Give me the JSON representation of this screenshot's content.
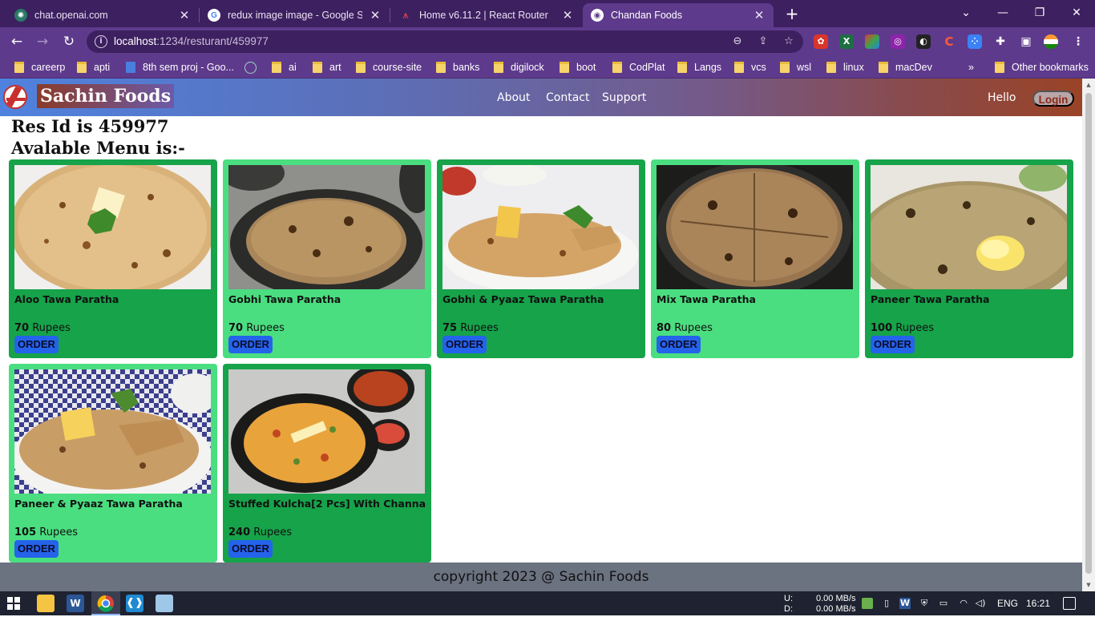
{
  "browser": {
    "tabs": [
      {
        "title": "chat.openai.com",
        "icon": "openai-icon",
        "active": false
      },
      {
        "title": "redux image image - Google Sea",
        "icon": "google-icon",
        "active": false
      },
      {
        "title": "Home v6.11.2 | React Router",
        "icon": "react-router-icon",
        "active": false
      },
      {
        "title": "Chandan Foods",
        "icon": "globe-icon",
        "active": true
      }
    ],
    "url_host": "localhost",
    "url_path": ":1234/resturant/459977",
    "bookmarks": [
      "careerp",
      "apti",
      "8th sem proj - Goo...",
      "ai",
      "art",
      "course-site",
      "banks",
      "digilock",
      "boot",
      "CodPlat",
      "Langs",
      "vcs",
      "wsl",
      "linux",
      "macDev"
    ],
    "bookmarks_more": "»",
    "other_bookmarks": "Other bookmarks"
  },
  "site": {
    "brand": "Sachin Foods",
    "nav": [
      "About",
      "Contact",
      "Support"
    ],
    "greeting": "Hello",
    "login_label": "Login",
    "res_id_text": "Res Id is 459977",
    "menu_heading": "Avalable Menu is:-",
    "footer": "copyright 2023 @ Sachin Foods"
  },
  "menu": [
    {
      "name": "Aloo Tawa Paratha",
      "price": "70",
      "unit": "Rupees",
      "order_label": "ORDER",
      "variant": "dark",
      "image": "paratha-butter-coriander"
    },
    {
      "name": "Gobhi Tawa Paratha",
      "price": "70",
      "unit": "Rupees",
      "order_label": "ORDER",
      "variant": "light",
      "image": "paratha-dark-plate"
    },
    {
      "name": "Gobhi & Pyaaz Tawa Paratha",
      "price": "75",
      "unit": "Rupees",
      "order_label": "ORDER",
      "variant": "dark",
      "image": "paratha-with-dips"
    },
    {
      "name": "Mix Tawa Paratha",
      "price": "80",
      "unit": "Rupees",
      "order_label": "ORDER",
      "variant": "light",
      "image": "paratha-black-plate"
    },
    {
      "name": "Paneer Tawa Paratha",
      "price": "100",
      "unit": "Rupees",
      "order_label": "ORDER",
      "variant": "dark",
      "image": "paratha-butter-closeup"
    },
    {
      "name": "Paneer & Pyaaz Tawa Paratha",
      "price": "105",
      "unit": "Rupees",
      "order_label": "ORDER",
      "variant": "light",
      "image": "paratha-checkered-cloth"
    },
    {
      "name": "Stuffed Kulcha[2 Pcs] With Channa",
      "price": "240",
      "unit": "Rupees",
      "order_label": "ORDER",
      "variant": "dark",
      "image": "kulcha-with-chana"
    }
  ],
  "taskbar": {
    "net_up_label": "U:",
    "net_down_label": "D:",
    "net_up": "0.00 MB/s",
    "net_down": "0.00 MB/s",
    "language": "ENG",
    "time": "16:21"
  }
}
